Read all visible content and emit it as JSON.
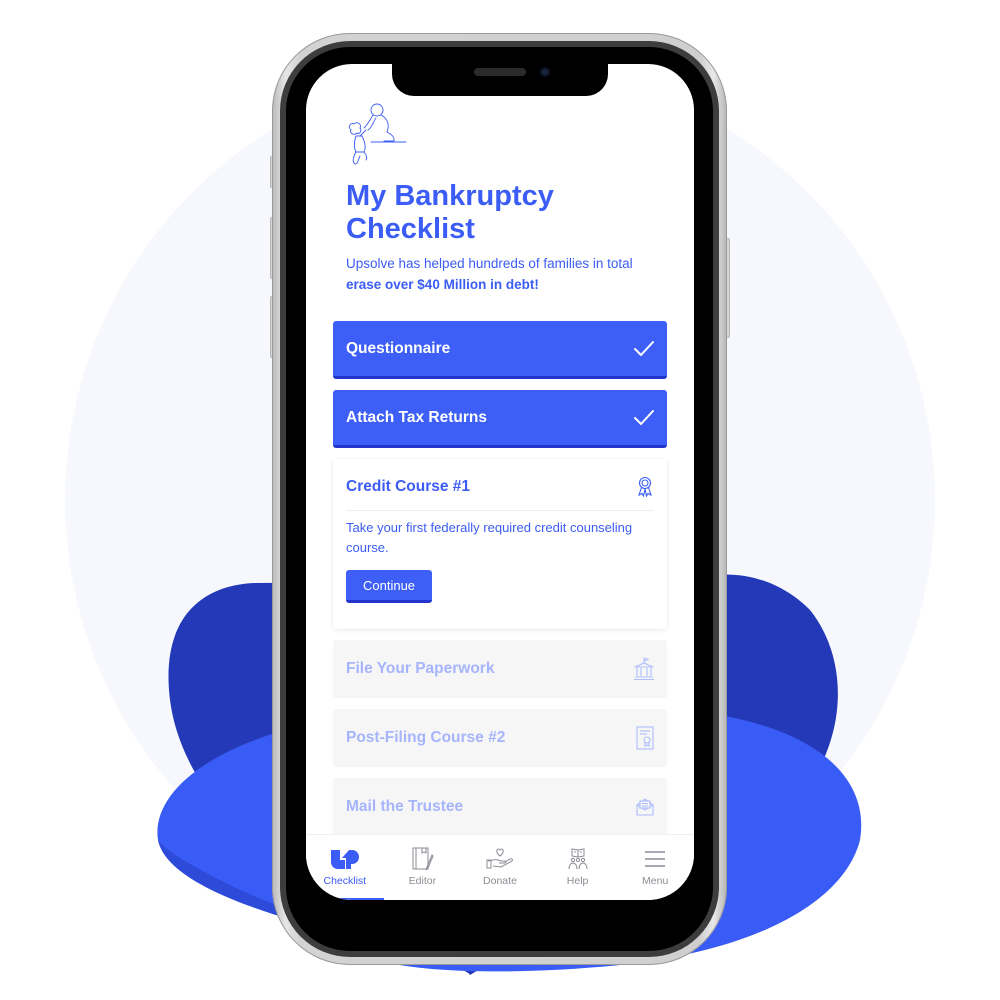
{
  "colors": {
    "brand": "#3b5cf5",
    "brand_dark": "#2335cc",
    "locked_text": "#a6b5fb",
    "background_circle": "#f7f8fe",
    "blob_dark": "#2339b8",
    "blob_light": "#3a5cf6"
  },
  "header": {
    "illustration": "helping-hand-illustration",
    "title": "My Bankruptcy Checklist",
    "subtitle_regular": "Upsolve has helped hundreds of families in total",
    "subtitle_bold": "erase over $40 Million in debt!"
  },
  "steps": [
    {
      "label": "Questionnaire",
      "status": "completed",
      "icon": "check-icon"
    },
    {
      "label": "Attach Tax Returns",
      "status": "completed",
      "icon": "check-icon"
    },
    {
      "label": "Credit Course #1",
      "status": "active",
      "icon": "ribbon-award-icon",
      "description": "Take your first federally required credit counseling course.",
      "button_label": "Continue"
    },
    {
      "label": "File Your Paperwork",
      "status": "locked",
      "icon": "courthouse-icon"
    },
    {
      "label": "Post-Filing Course #2",
      "status": "locked",
      "icon": "certificate-icon"
    },
    {
      "label": "Mail the Trustee",
      "status": "locked",
      "icon": "open-envelope-icon"
    }
  ],
  "tabbar": {
    "active": "Checklist",
    "tabs": [
      {
        "label": "Checklist",
        "icon": "upsolve-logo-icon"
      },
      {
        "label": "Editor",
        "icon": "notebook-pen-icon"
      },
      {
        "label": "Donate",
        "icon": "heart-hand-icon"
      },
      {
        "label": "Help",
        "icon": "community-book-icon"
      },
      {
        "label": "Menu",
        "icon": "hamburger-menu-icon"
      }
    ]
  }
}
